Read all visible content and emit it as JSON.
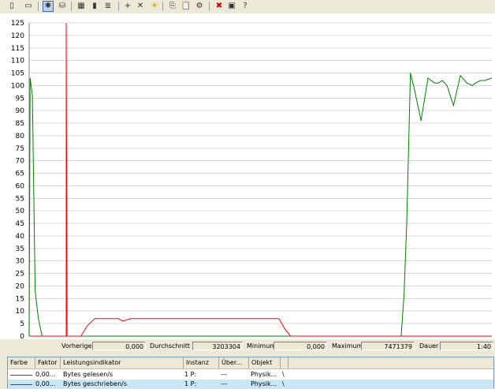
{
  "toolbar": {
    "buttons": [
      {
        "name": "new-counter-set-icon",
        "glyph": "▯"
      },
      {
        "name": "clear-display-icon",
        "glyph": "▭"
      },
      {
        "name": "view-current-activity-icon",
        "glyph": "✱"
      },
      {
        "name": "view-log-data-icon",
        "glyph": "⛁"
      },
      {
        "name": "view-graph-icon",
        "glyph": "▦"
      },
      {
        "name": "view-histogram-icon",
        "glyph": "▮"
      },
      {
        "name": "view-report-icon",
        "glyph": "≣"
      },
      {
        "name": "add-counter-icon",
        "glyph": "+"
      },
      {
        "name": "delete-counter-icon",
        "glyph": "✕"
      },
      {
        "name": "highlight-icon",
        "glyph": "☀"
      },
      {
        "name": "copy-properties-icon",
        "glyph": "⎘"
      },
      {
        "name": "paste-counter-list-icon",
        "glyph": "📋"
      },
      {
        "name": "properties-icon",
        "glyph": "⚙"
      },
      {
        "name": "freeze-display-icon",
        "glyph": "✖"
      },
      {
        "name": "update-data-icon",
        "glyph": "▣"
      },
      {
        "name": "help-icon",
        "glyph": "?"
      }
    ]
  },
  "chart_data": {
    "type": "line",
    "ylim": [
      0,
      125
    ],
    "yticks": [
      "0",
      "5",
      "10",
      "15",
      "20",
      "25",
      "30",
      "35",
      "40",
      "45",
      "50",
      "55",
      "60",
      "65",
      "70",
      "75",
      "80",
      "85",
      "90",
      "95",
      "100",
      "105",
      "110",
      "115",
      "120",
      "125"
    ],
    "xlim": [
      0,
      100
    ],
    "grid": true,
    "cursor_x": 8,
    "series": [
      {
        "color": "#008000",
        "x": [
          0,
          0.2,
          0.7,
          1.3,
          2,
          2.8,
          4,
          75,
          75.2,
          80,
          80.4,
          81,
          81.6,
          82.4,
          83.2,
          84.7,
          86.2,
          87.6,
          88.4,
          89.3,
          90.3,
          91.7,
          93.2,
          94.6,
          95.8,
          96.5,
          97.5,
          98.5,
          100
        ],
        "y": [
          0,
          103,
          96,
          18,
          7,
          0,
          0,
          0,
          0,
          0,
          0,
          16,
          45,
          105,
          99,
          86,
          103,
          101,
          101,
          102,
          100,
          92,
          104,
          101,
          100,
          101,
          102,
          102,
          103
        ]
      },
      {
        "color": "#ff0000",
        "x": [
          0,
          8,
          8,
          8,
          8.2,
          10.5,
          11.2,
          12.5,
          14.2,
          15.3,
          18,
          19.3,
          20.2,
          22,
          36,
          38,
          40,
          42,
          54,
          55.2,
          56.5,
          100
        ],
        "y": [
          0,
          0,
          125,
          125,
          0,
          0,
          0,
          4,
          7,
          7,
          7,
          7,
          6,
          7,
          7,
          7,
          7,
          7,
          7,
          3,
          0,
          0
        ]
      }
    ]
  },
  "stats": {
    "previous_label": "Vorherige",
    "previous_value": "0,000",
    "average_label": "Durchschnitt",
    "average_value": "3203304",
    "minimum_label": "Minimum",
    "minimum_value": "0,000",
    "maximum_label": "Maximum",
    "maximum_value": "7471379",
    "duration_label": "Dauer",
    "duration_value": "1:40"
  },
  "table": {
    "headers": [
      "Farbe",
      "Faktor",
      "Leistungsindikator",
      "Instanz",
      "Über...",
      "Objekt"
    ],
    "rows": [
      {
        "color": "#008000",
        "factor": "0,00...",
        "counter": "Bytes gelesen/s",
        "instance": "1 P:",
        "parent": "---",
        "object": "Physik...",
        "computer": "\\",
        "selected": false
      },
      {
        "color": "#ff0000",
        "factor": "0,00...",
        "counter": "Bytes geschrieben/s",
        "instance": "1 P:",
        "parent": "---",
        "object": "Physik...",
        "computer": "\\",
        "selected": true
      }
    ]
  }
}
